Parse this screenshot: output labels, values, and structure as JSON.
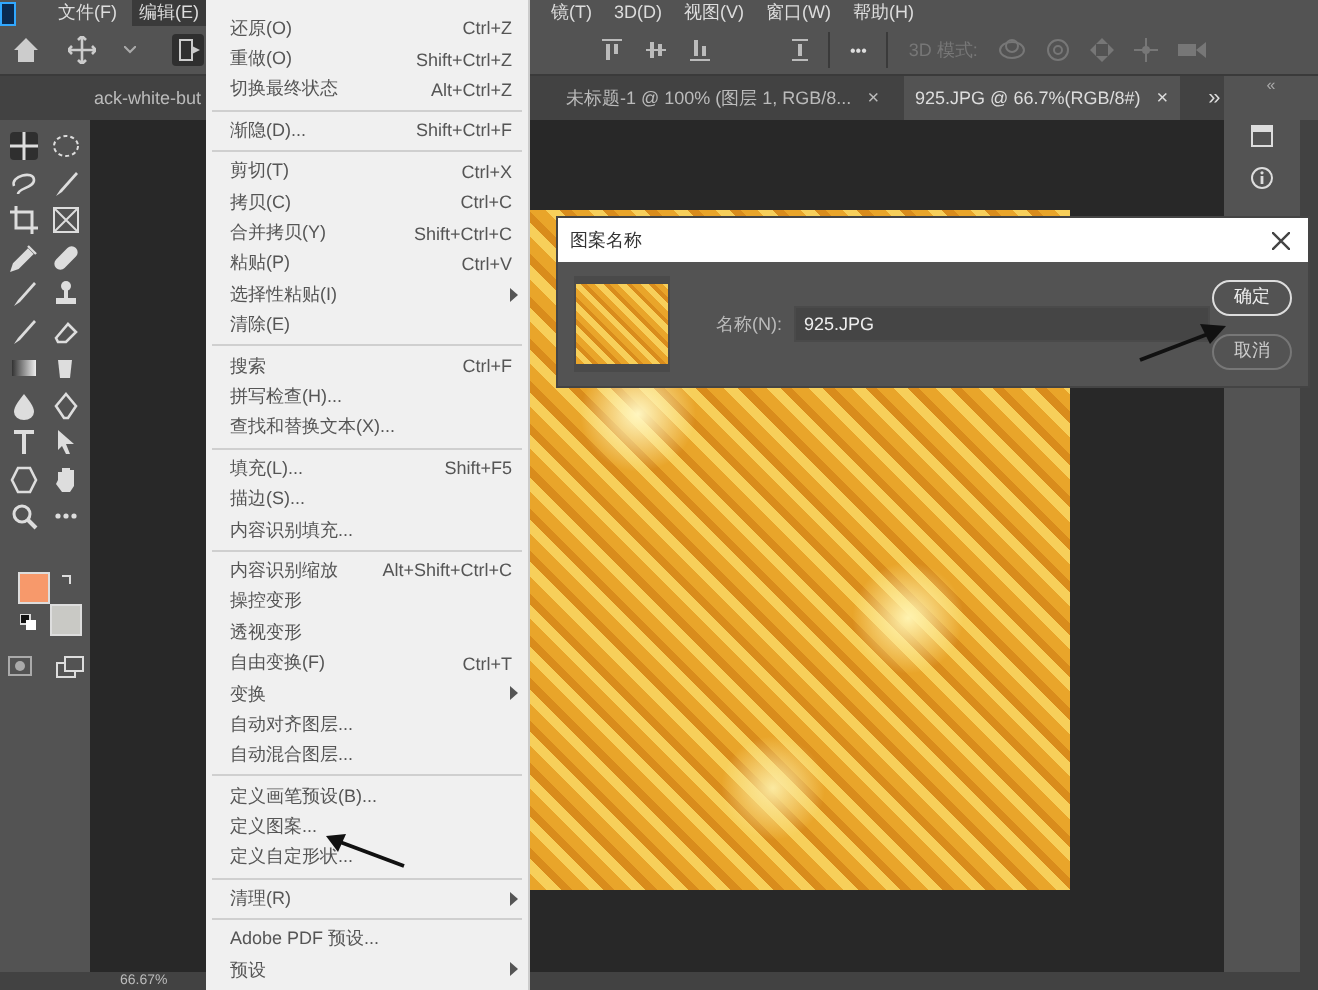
{
  "menubar": {
    "items": [
      {
        "label": "文件(F)",
        "selected": false
      },
      {
        "label": "编辑(E)",
        "selected": true
      },
      {
        "label": "镜(T)",
        "selected": false
      },
      {
        "label": "3D(D)",
        "selected": false
      },
      {
        "label": "视图(V)",
        "selected": false
      },
      {
        "label": "窗口(W)",
        "selected": false
      },
      {
        "label": "帮助(H)",
        "selected": false
      }
    ]
  },
  "options_bar": {
    "more": "•••",
    "mode_label": "3D 模式:"
  },
  "tabs": {
    "items": [
      {
        "label": "ack-white-but",
        "selected": false
      },
      {
        "label": "未标题-1 @ 100% (图层 1, RGB/8...",
        "selected": false,
        "close": "×"
      },
      {
        "label": "925.JPG @ 66.7%(RGB/8#)",
        "selected": true,
        "close": "×"
      }
    ],
    "overflow": "»"
  },
  "right_panel": {
    "collapse": "«"
  },
  "toolbar": {
    "swatches": [
      {
        "color": "#f7996b"
      },
      {
        "color": "#c9c9c5"
      }
    ]
  },
  "edit_menu": {
    "groups": [
      {
        "items": [
          {
            "label": "还原(O)",
            "shortcut": "Ctrl+Z",
            "submenu": false
          },
          {
            "label": "重做(O)",
            "shortcut": "Shift+Ctrl+Z",
            "submenu": false
          },
          {
            "label": "切换最终状态",
            "shortcut": "Alt+Ctrl+Z",
            "submenu": false
          }
        ]
      },
      {
        "items": [
          {
            "label": "渐隐(D)...",
            "shortcut": "Shift+Ctrl+F",
            "submenu": false
          }
        ]
      },
      {
        "items": [
          {
            "label": "剪切(T)",
            "shortcut": "Ctrl+X",
            "submenu": false
          },
          {
            "label": "拷贝(C)",
            "shortcut": "Ctrl+C",
            "submenu": false
          },
          {
            "label": "合并拷贝(Y)",
            "shortcut": "Shift+Ctrl+C",
            "submenu": false
          },
          {
            "label": "粘贴(P)",
            "shortcut": "Ctrl+V",
            "submenu": false
          },
          {
            "label": "选择性粘贴(I)",
            "submenu": true
          },
          {
            "label": "清除(E)",
            "submenu": false
          }
        ]
      },
      {
        "items": [
          {
            "label": "搜索",
            "shortcut": "Ctrl+F",
            "submenu": false
          },
          {
            "label": "拼写检查(H)...",
            "submenu": false
          },
          {
            "label": "查找和替换文本(X)...",
            "submenu": false
          }
        ]
      },
      {
        "items": [
          {
            "label": "填充(L)...",
            "shortcut": "Shift+F5",
            "submenu": false
          },
          {
            "label": "描边(S)...",
            "submenu": false
          },
          {
            "label": "内容识别填充...",
            "submenu": false
          }
        ]
      },
      {
        "items": [
          {
            "label": "内容识别缩放",
            "shortcut": "Alt+Shift+Ctrl+C",
            "submenu": false
          },
          {
            "label": "操控变形",
            "submenu": false
          },
          {
            "label": "透视变形",
            "submenu": false
          },
          {
            "label": "自由变换(F)",
            "shortcut": "Ctrl+T",
            "submenu": false
          },
          {
            "label": "变换",
            "submenu": true
          },
          {
            "label": "自动对齐图层...",
            "submenu": false
          },
          {
            "label": "自动混合图层...",
            "submenu": false
          }
        ]
      },
      {
        "items": [
          {
            "label": "定义画笔预设(B)...",
            "submenu": false
          },
          {
            "label": "定义图案...",
            "submenu": false
          },
          {
            "label": "定义自定形状...",
            "submenu": false
          }
        ]
      },
      {
        "items": [
          {
            "label": "清理(R)",
            "submenu": true
          }
        ]
      },
      {
        "items": [
          {
            "label": "Adobe PDF 预设...",
            "submenu": false
          },
          {
            "label": "预设",
            "submenu": true
          }
        ]
      }
    ]
  },
  "dialog": {
    "title": "图案名称",
    "name_label": "名称(N):",
    "name_value": "925.JPG",
    "buttons": [
      {
        "label": "确定",
        "selected": true
      },
      {
        "label": "取消",
        "selected": false
      }
    ]
  },
  "status_bar": {
    "zoom": "66.67%"
  }
}
